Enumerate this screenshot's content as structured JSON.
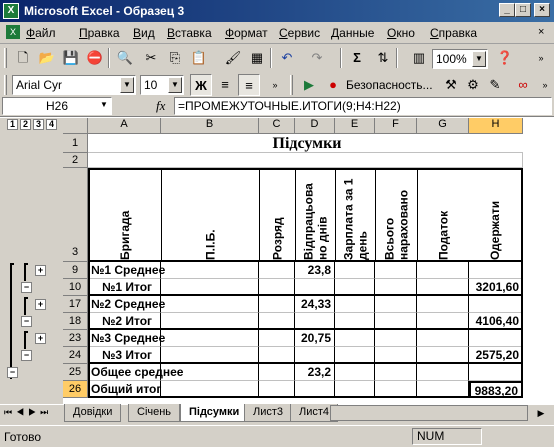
{
  "window": {
    "title": "Microsoft Excel - Образец 3",
    "minimize": "_",
    "maximize": "□",
    "close": "×"
  },
  "menu": [
    "Файл",
    "Правка",
    "Вид",
    "Вставка",
    "Формат",
    "Сервис",
    "Данные",
    "Окно",
    "Справка"
  ],
  "toolbar": {
    "zoom": "100%",
    "font": "Arial Cyr",
    "size": "10",
    "bold": "Ж",
    "security": "Безопасность..."
  },
  "formula": {
    "namebox": "H26",
    "fx": "fx",
    "value": "=ПРОМЕЖУТОЧНЫЕ.ИТОГИ(9;H4:H22)"
  },
  "outline_levels": [
    "1",
    "2",
    "3",
    "4"
  ],
  "columns": [
    "A",
    "B",
    "C",
    "D",
    "E",
    "F",
    "G",
    "H"
  ],
  "title": "Підсумки",
  "headers": {
    "a": "Бригада",
    "b": "П.І.Б.",
    "c": "Розряд",
    "d": "Відпрацьова но днів",
    "e": "Зарплата за 1 день",
    "f": "Всього нараховано",
    "g": "Податок",
    "h": "Одержати"
  },
  "rows": [
    {
      "num": "9",
      "a": "№1 Среднее",
      "d": "23,8",
      "h": ""
    },
    {
      "num": "10",
      "a": "№1 Итог",
      "d": "",
      "h": "3201,60"
    },
    {
      "num": "17",
      "a": "№2 Среднее",
      "d": "24,33",
      "h": ""
    },
    {
      "num": "18",
      "a": "№2 Итог",
      "d": "",
      "h": "4106,40"
    },
    {
      "num": "23",
      "a": "№3 Среднее",
      "d": "20,75",
      "h": ""
    },
    {
      "num": "24",
      "a": "№3 Итог",
      "d": "",
      "h": "2575,20"
    },
    {
      "num": "25",
      "a": "Общее среднее",
      "d": "23,2",
      "h": ""
    },
    {
      "num": "26",
      "a": "Общий итог",
      "d": "",
      "h": "9883,20"
    }
  ],
  "rownums": {
    "r1": "1",
    "r2": "2",
    "r3": "3"
  },
  "sheets": [
    "Довідки",
    "Січень",
    "Підсумки",
    "Лист3",
    "Лист4"
  ],
  "status": {
    "ready": "Готово",
    "num": "NUM"
  }
}
